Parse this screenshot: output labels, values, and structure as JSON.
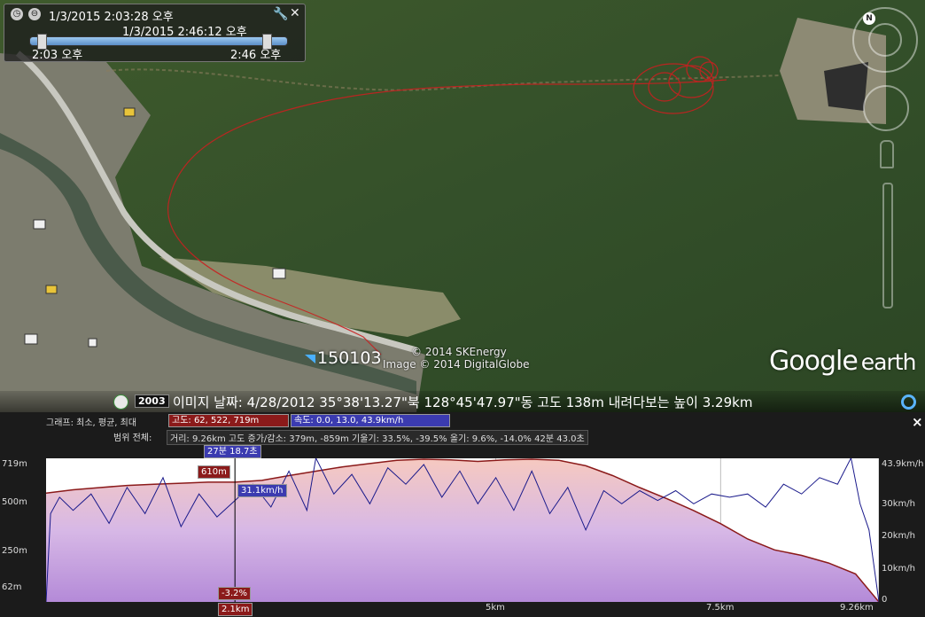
{
  "time_slider": {
    "start_datetime": "1/3/2015   2:03:28 오후",
    "end_datetime": "1/3/2015   2:46:12 오후",
    "start_label": "2:03 오후",
    "end_label": "2:46 오후"
  },
  "map": {
    "placemark_label": "150103",
    "copyright_1": "© 2014 SKEnergy",
    "copyright_2": "Image © 2014 DigitalGlobe",
    "logo_google": "Google",
    "logo_earth": "earth",
    "nav_north": "N"
  },
  "status_bar": {
    "imagery_year": "2003",
    "text": "이미지 날짜: 4/28/2012     35°38'13.27\"북 128°45'47.97\"동  고도     138m     내려다보는 높이     3.29km"
  },
  "profile": {
    "graph_label": "그래프: 최소, 평균, 최대",
    "altitude_stat": "고도: 62, 522, 719m",
    "speed_stat": "속도: 0.0, 13.0, 43.9km/h",
    "range_label": "범위 전체:",
    "range_stats": "거리: 9.26km 고도 증가/감소: 379m, -859m 기울기: 33.5%, -39.5% 올기: 9.6%, -14.0% 42분 43.0초",
    "cursor_time": "27분 18.7초",
    "cursor_altitude": "610m",
    "cursor_speed": "31.1km/h",
    "cursor_slope": "-3.2%",
    "cursor_distance": "2.1km",
    "close_icon": "×",
    "altitude_color": "#8b1a1a",
    "speed_color": "#1a1a8b"
  },
  "chart_data": {
    "type": "line",
    "x_unit": "km",
    "xlim": [
      0,
      9.26
    ],
    "x_ticks": [
      "2.1km",
      "5km",
      "7.5km",
      "9.26km"
    ],
    "x_tick_values": [
      2.1,
      5,
      7.5,
      9.26
    ],
    "left_axis": {
      "ticks": [
        "719m",
        "500m",
        "250m",
        "62m"
      ],
      "tick_values": [
        719,
        500,
        250,
        62
      ],
      "ylim": [
        62,
        719
      ]
    },
    "right_axis": {
      "ticks": [
        "43.9km/h",
        "30km/h",
        "20km/h",
        "10km/h",
        "0"
      ],
      "tick_values": [
        43.9,
        30,
        20,
        10,
        0
      ],
      "ylim": [
        0,
        43.9
      ]
    },
    "series": [
      {
        "name": "고도",
        "axis": "left",
        "x": [
          0,
          0.3,
          0.6,
          0.9,
          1.2,
          1.5,
          1.8,
          2.1,
          2.4,
          2.7,
          3.0,
          3.3,
          3.6,
          3.9,
          4.2,
          4.5,
          4.8,
          5.1,
          5.4,
          5.7,
          6.0,
          6.3,
          6.6,
          6.9,
          7.2,
          7.5,
          7.8,
          8.1,
          8.4,
          8.7,
          9.0,
          9.26
        ],
        "values": [
          560,
          575,
          585,
          595,
          600,
          605,
          610,
          610,
          618,
          640,
          660,
          680,
          695,
          710,
          715,
          712,
          705,
          712,
          715,
          710,
          685,
          640,
          585,
          535,
          480,
          420,
          350,
          300,
          275,
          240,
          190,
          62
        ]
      },
      {
        "name": "속도",
        "axis": "right",
        "x": [
          0,
          0.05,
          0.15,
          0.3,
          0.5,
          0.7,
          0.9,
          1.1,
          1.3,
          1.5,
          1.7,
          1.9,
          2.1,
          2.3,
          2.5,
          2.7,
          2.9,
          3.0,
          3.2,
          3.4,
          3.6,
          3.8,
          4.0,
          4.2,
          4.4,
          4.6,
          4.8,
          5.0,
          5.2,
          5.4,
          5.6,
          5.8,
          6.0,
          6.2,
          6.4,
          6.6,
          6.8,
          7.0,
          7.2,
          7.4,
          7.6,
          7.8,
          8.0,
          8.2,
          8.4,
          8.6,
          8.8,
          8.95,
          9.05,
          9.15,
          9.26
        ],
        "values": [
          0,
          27,
          32,
          28,
          33,
          24,
          35,
          27,
          38,
          23,
          33,
          26,
          31,
          36,
          29,
          40,
          28,
          44,
          33,
          39,
          30,
          41,
          36,
          42,
          32,
          40,
          30,
          38,
          28,
          40,
          27,
          35,
          22,
          34,
          30,
          34,
          31,
          34,
          30,
          33,
          32,
          33,
          29,
          36,
          33,
          38,
          36,
          44,
          30,
          22,
          0
        ]
      }
    ]
  }
}
